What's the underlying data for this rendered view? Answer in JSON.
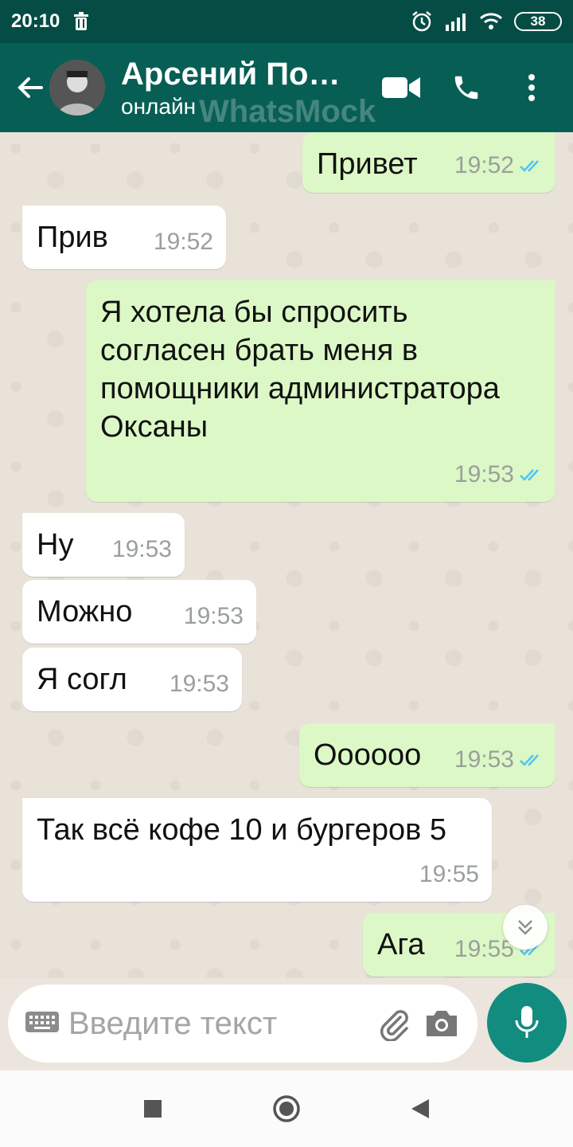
{
  "status_bar": {
    "time": "20:10",
    "battery": "38"
  },
  "header": {
    "name": "Арсений По…",
    "status": "онлайн",
    "watermark": "WhatsMock"
  },
  "messages": [
    {
      "dir": "out",
      "text": "Привет",
      "time": "19:52"
    },
    {
      "dir": "in",
      "text": "Прив",
      "time": "19:52"
    },
    {
      "dir": "out",
      "text": "Я хотела бы спросить согласен брать меня в помощники администратора Оксаны",
      "time": "19:53"
    },
    {
      "dir": "in",
      "text": "Ну",
      "time": "19:53"
    },
    {
      "dir": "in",
      "text": "Можно",
      "time": "19:53"
    },
    {
      "dir": "in",
      "text": "Я согл",
      "time": "19:53"
    },
    {
      "dir": "out",
      "text": "Оооооо",
      "time": "19:53"
    },
    {
      "dir": "in",
      "text": "Так всё кофе 10 и бургеров 5",
      "time": "19:55"
    },
    {
      "dir": "out",
      "text": "Ага",
      "time": "19:55"
    }
  ],
  "composer": {
    "placeholder": "Введите текст"
  },
  "colors": {
    "header": "#075e54",
    "status_bar": "#054d44",
    "outgoing": "#dcf8c6",
    "incoming": "#ffffff",
    "tick": "#4fc3f7",
    "mic": "#128c7e"
  }
}
